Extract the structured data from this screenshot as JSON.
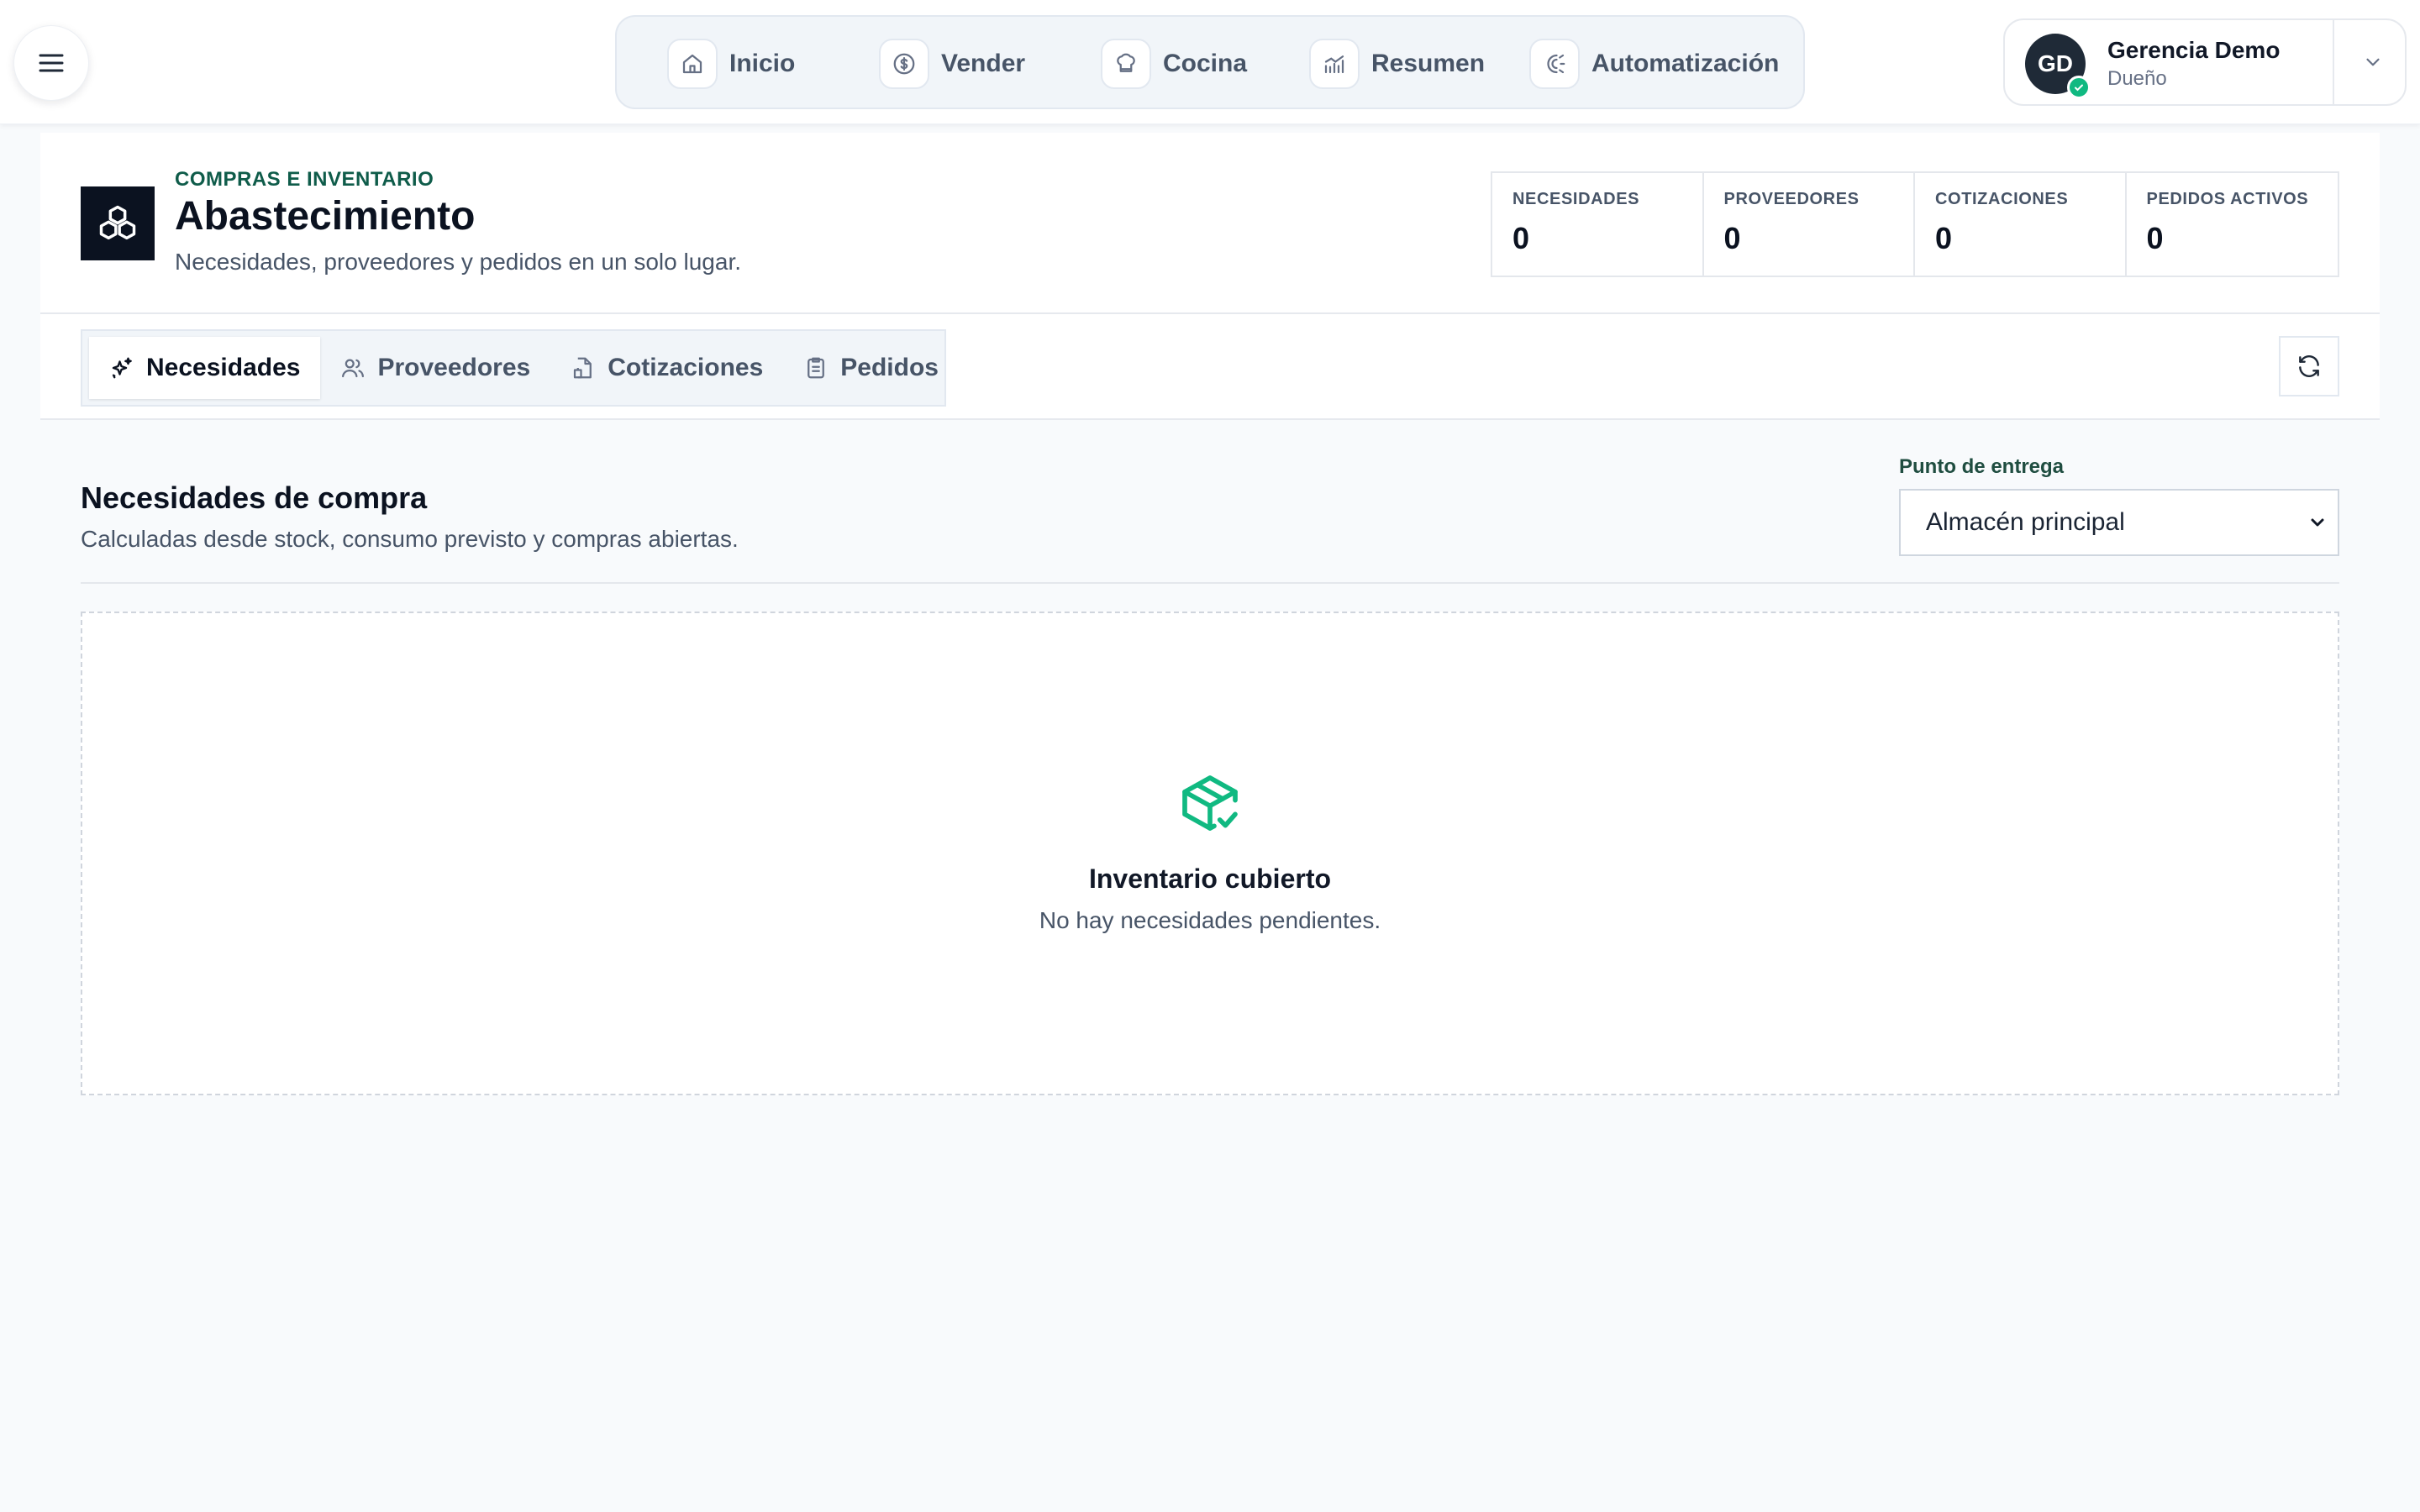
{
  "topbar": {
    "nav": [
      {
        "label": "Inicio",
        "icon": "home-icon"
      },
      {
        "label": "Vender",
        "icon": "dollar-circle-icon"
      },
      {
        "label": "Cocina",
        "icon": "chef-hat-icon"
      },
      {
        "label": "Resumen",
        "icon": "bar-chart-icon"
      },
      {
        "label": "Automatización",
        "icon": "automation-icon"
      }
    ],
    "user": {
      "initials": "GD",
      "name": "Gerencia Demo",
      "role": "Dueño",
      "status_color": "#10b981"
    }
  },
  "header": {
    "eyebrow": "COMPRAS E INVENTARIO",
    "title": "Abastecimiento",
    "subtitle": "Necesidades, proveedores y pedidos en un solo lugar.",
    "stats": [
      {
        "label": "NECESIDADES",
        "value": "0"
      },
      {
        "label": "PROVEEDORES",
        "value": "0"
      },
      {
        "label": "COTIZACIONES",
        "value": "0"
      },
      {
        "label": "PEDIDOS ACTIVOS",
        "value": "0"
      }
    ]
  },
  "tabs": [
    {
      "label": "Necesidades",
      "icon": "sparkles-icon",
      "active": true
    },
    {
      "label": "Proveedores",
      "icon": "users-icon",
      "active": false
    },
    {
      "label": "Cotizaciones",
      "icon": "document-icon",
      "active": false
    },
    {
      "label": "Pedidos",
      "icon": "clipboard-icon",
      "active": false
    }
  ],
  "section": {
    "title": "Necesidades de compra",
    "subtitle": "Calculadas desde stock, consumo previsto y compras abiertas.",
    "delivery_label": "Punto de entrega",
    "delivery_value": "Almacén principal"
  },
  "empty_state": {
    "title": "Inventario cubierto",
    "subtitle": "No hay necesidades pendientes.",
    "icon": "package-check-icon",
    "accent": "#10b981"
  }
}
